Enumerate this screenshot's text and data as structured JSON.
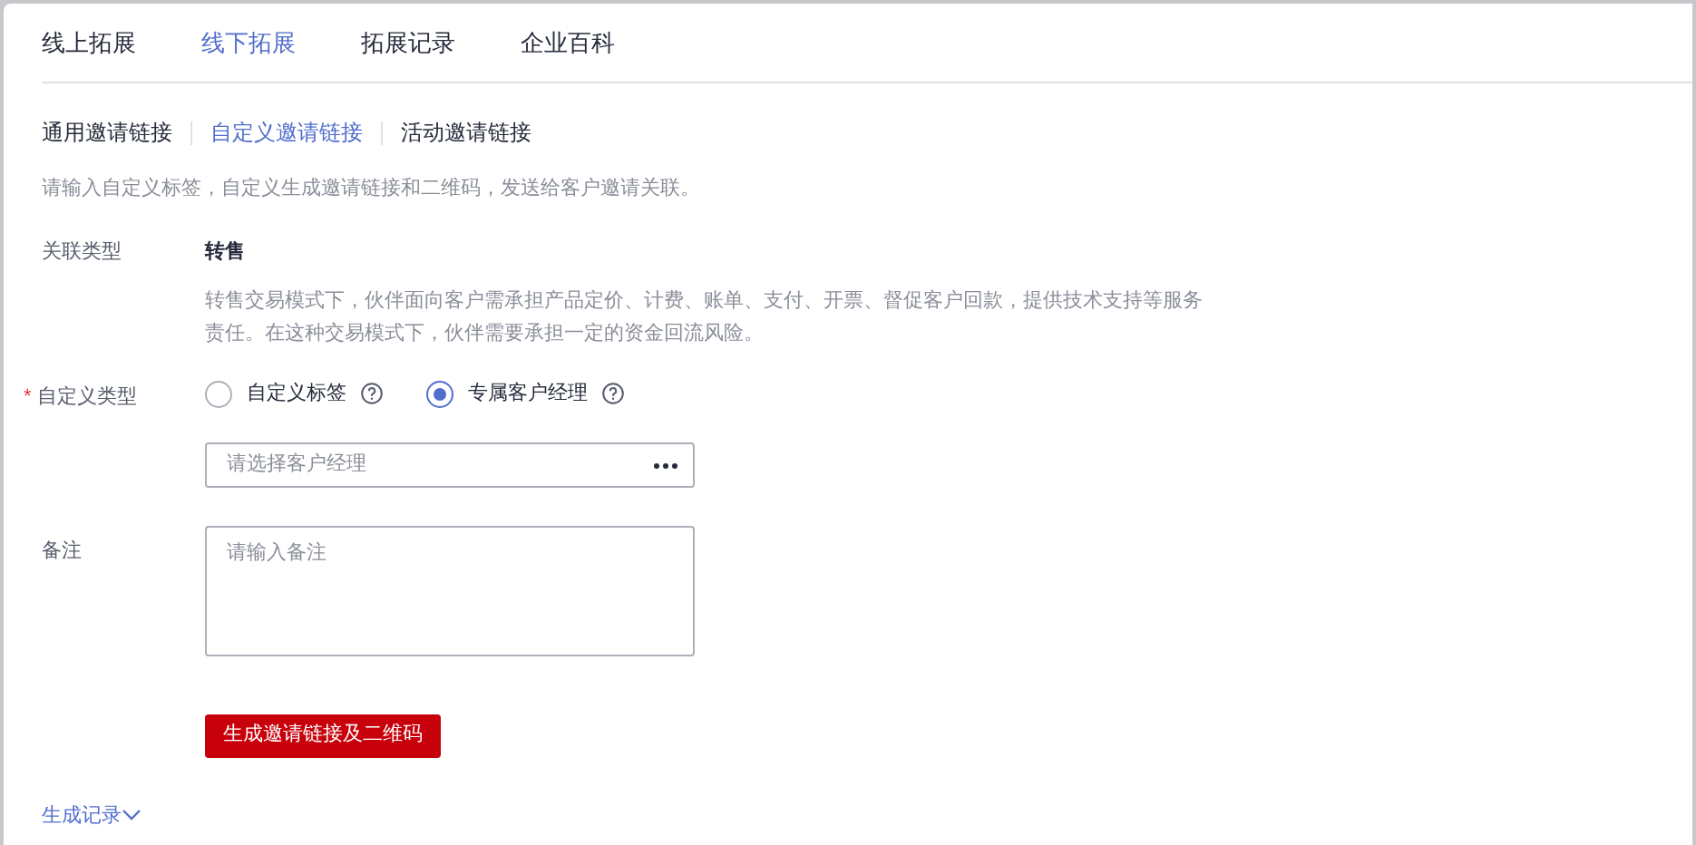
{
  "tabs": [
    {
      "label": "线上拓展",
      "selected": false
    },
    {
      "label": "线下拓展",
      "selected": true
    },
    {
      "label": "拓展记录",
      "selected": false
    },
    {
      "label": "企业百科",
      "selected": false
    }
  ],
  "subtabs": [
    {
      "label": "通用邀请链接",
      "selected": false
    },
    {
      "label": "自定义邀请链接",
      "selected": true
    },
    {
      "label": "活动邀请链接",
      "selected": false
    }
  ],
  "hint": "请输入自定义标签，自定义生成邀请链接和二维码，发送给客户邀请关联。",
  "relation": {
    "label": "关联类型",
    "value": "转售",
    "description": "转售交易模式下，伙伴面向客户需承担产品定价、计费、账单、支付、开票、督促客户回款，提供技术支持等服务责任。在这种交易模式下，伙伴需要承担一定的资金回流风险。"
  },
  "custom_type": {
    "label": "自定义类型",
    "required_mark": "*",
    "options": [
      {
        "label": "自定义标签",
        "selected": false
      },
      {
        "label": "专属客户经理",
        "selected": true
      }
    ]
  },
  "manager_field": {
    "placeholder": "请选择客户经理"
  },
  "remark": {
    "label": "备注",
    "placeholder": "请输入备注"
  },
  "generate_button": "生成邀请链接及二维码",
  "history_link": "生成记录"
}
